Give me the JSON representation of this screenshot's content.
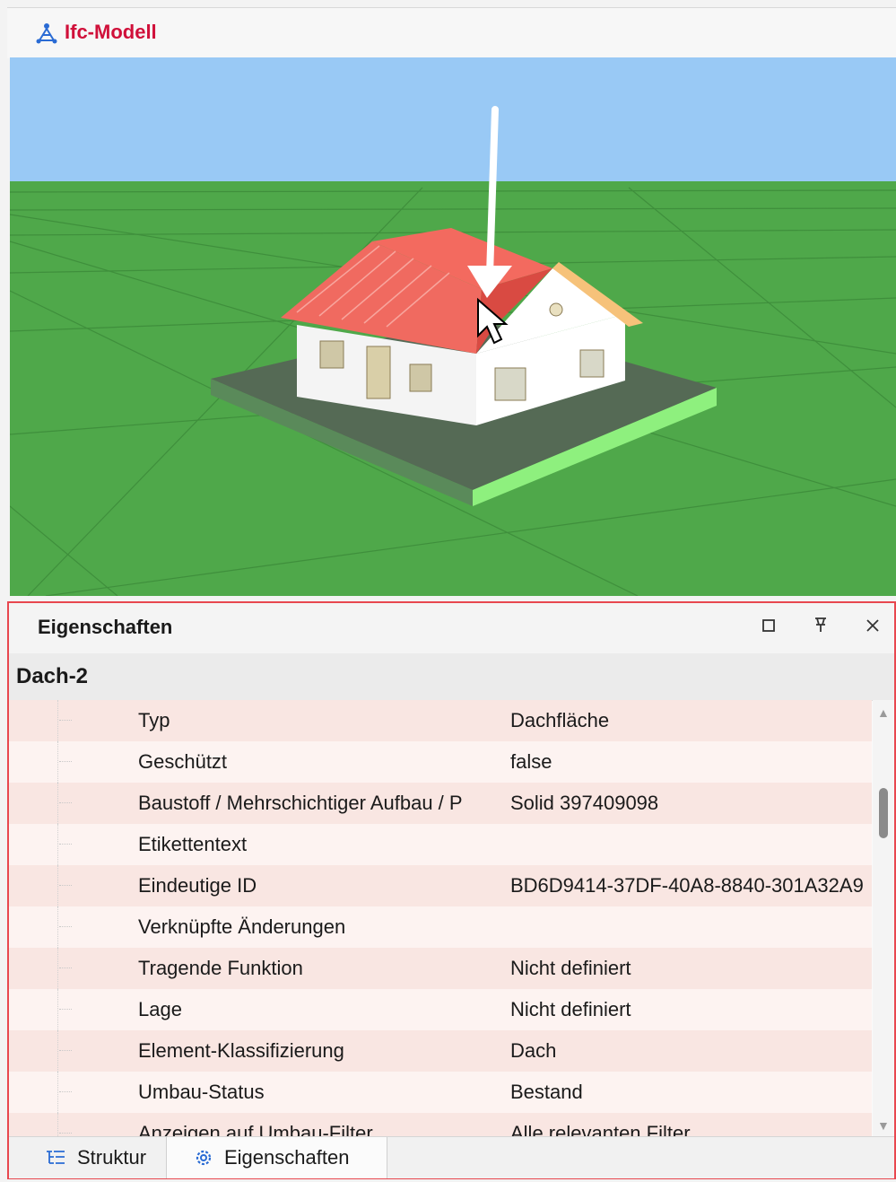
{
  "window": {
    "title": "Ifc-Modell",
    "title_color": "#d0103a",
    "icon": "ifc-model-icon"
  },
  "viewport": {
    "sky_color": "#99c9f5",
    "ground_color": "#4fa84a",
    "selection_color": "#f0554e",
    "description_icon": "house-3d-model"
  },
  "properties": {
    "title": "Eigenschaften",
    "header_buttons": [
      "maximize-icon",
      "pin-icon",
      "close-icon"
    ],
    "group": "Dach-2",
    "rows": [
      {
        "name": "Typ",
        "value": "Dachfläche"
      },
      {
        "name": "Geschützt",
        "value": "false"
      },
      {
        "name": "Baustoff / Mehrschichtiger Aufbau / P",
        "value": "Solid 397409098"
      },
      {
        "name": "Etikettentext",
        "value": ""
      },
      {
        "name": "Eindeutige ID",
        "value": "BD6D9414-37DF-40A8-8840-301A32A9"
      },
      {
        "name": "Verknüpfte Änderungen",
        "value": ""
      },
      {
        "name": "Tragende Funktion",
        "value": "Nicht definiert"
      },
      {
        "name": "Lage",
        "value": "Nicht definiert"
      },
      {
        "name": "Element-Klassifizierung",
        "value": "Dach"
      },
      {
        "name": "Umbau-Status",
        "value": "Bestand"
      },
      {
        "name": "Anzeigen auf Umbau-Filter",
        "value": "Alle relevanten Filter"
      }
    ],
    "tabs": [
      {
        "label": "Struktur",
        "icon": "tree-structure-icon"
      },
      {
        "label": "Eigenschaften",
        "icon": "gear-icon"
      }
    ]
  }
}
